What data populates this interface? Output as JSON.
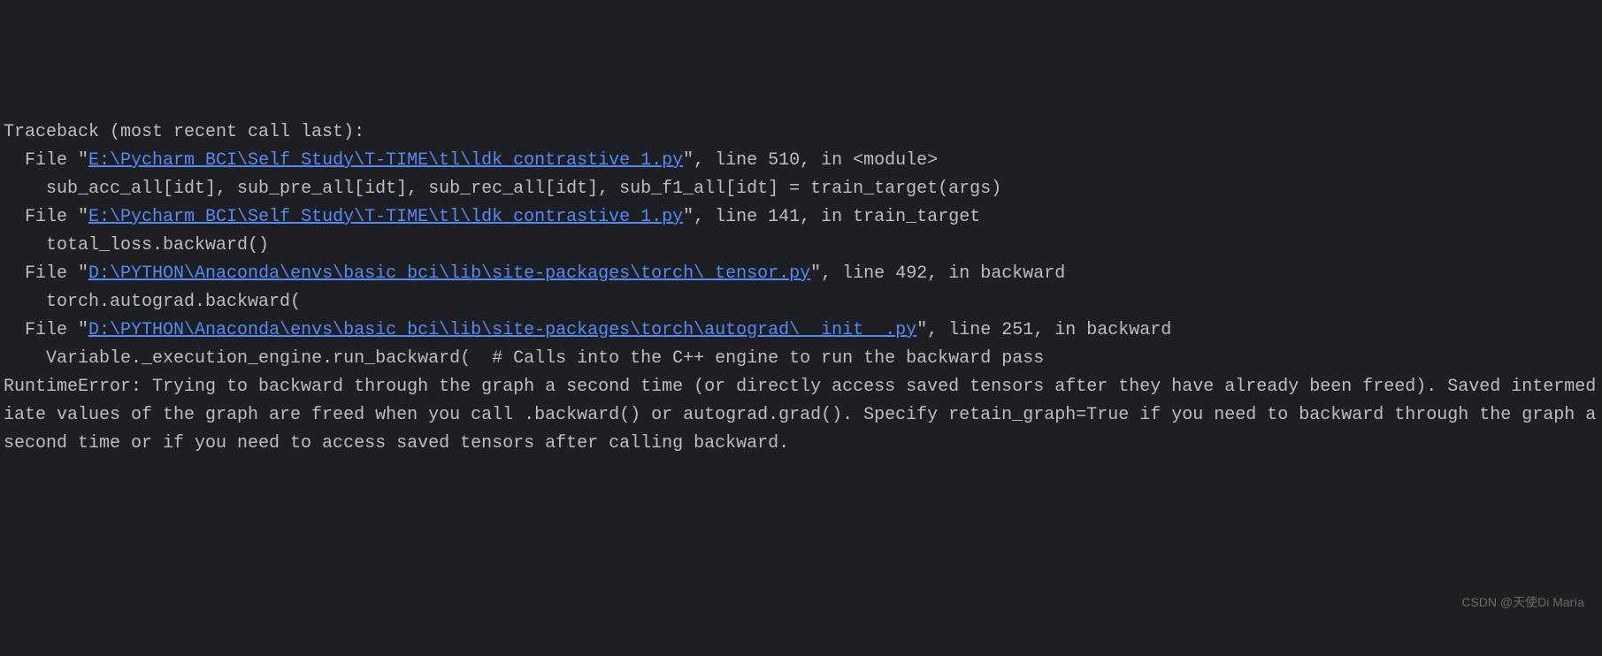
{
  "traceback": {
    "header": "Traceback (most recent call last):",
    "frames": [
      {
        "prefix": "  File \"",
        "path": "E:\\Pycharm_BCI\\Self_Study\\T-TIME\\tl\\ldk_contrastive_1.py",
        "suffix": "\", line 510, in <module>",
        "code": "    sub_acc_all[idt], sub_pre_all[idt], sub_rec_all[idt], sub_f1_all[idt] = train_target(args)"
      },
      {
        "prefix": "  File \"",
        "path": "E:\\Pycharm_BCI\\Self_Study\\T-TIME\\tl\\ldk_contrastive_1.py",
        "suffix": "\", line 141, in train_target",
        "code": "    total_loss.backward()"
      },
      {
        "prefix": "  File \"",
        "path": "D:\\PYTHON\\Anaconda\\envs\\basic_bci\\lib\\site-packages\\torch\\_tensor.py",
        "suffix": "\", line 492, in backward",
        "code": "    torch.autograd.backward("
      },
      {
        "prefix": "  File \"",
        "path": "D:\\PYTHON\\Anaconda\\envs\\basic_bci\\lib\\site-packages\\torch\\autograd\\__init__.py",
        "suffix": "\", line 251, in backward",
        "code": "    Variable._execution_engine.run_backward(  # Calls into the C++ engine to run the backward pass"
      }
    ],
    "error": "RuntimeError: Trying to backward through the graph a second time (or directly access saved tensors after they have already been freed). Saved intermediate values of the graph are freed when you call .backward() or autograd.grad(). Specify retain_graph=True if you need to backward through the graph a second time or if you need to access saved tensors after calling backward."
  },
  "watermark": "CSDN @天使Di María"
}
